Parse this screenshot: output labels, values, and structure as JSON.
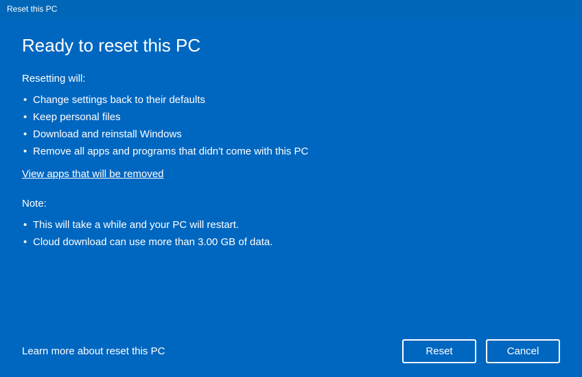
{
  "window": {
    "title": "Reset this PC"
  },
  "heading": "Ready to reset this PC",
  "resetting": {
    "label": "Resetting will:",
    "items": [
      "Change settings back to their defaults",
      "Keep personal files",
      "Download and reinstall Windows",
      "Remove all apps and programs that didn't come with this PC"
    ]
  },
  "view_apps_link": "View apps that will be removed",
  "note": {
    "label": "Note:",
    "items": [
      "This will take a while and your PC will restart.",
      "Cloud download can use more than 3.00 GB of data."
    ]
  },
  "learn_more": "Learn more about reset this PC",
  "buttons": {
    "reset": "Reset",
    "cancel": "Cancel"
  }
}
